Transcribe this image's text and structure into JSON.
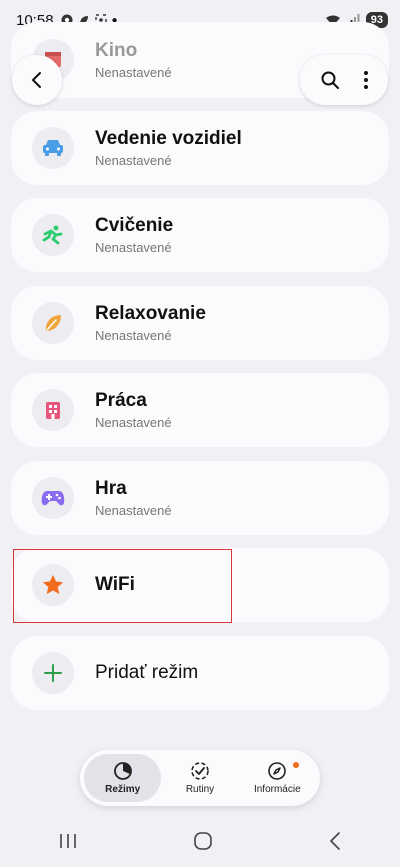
{
  "status_bar": {
    "time": "10:58",
    "battery": "93"
  },
  "header": {
    "back_icon": "chevron-left-icon",
    "search_icon": "search-icon",
    "more_icon": "more-vert-icon"
  },
  "modes": [
    {
      "title": "Kino",
      "subtitle": "Nenastavené",
      "icon": "film-icon"
    },
    {
      "title": "Vedenie vozidiel",
      "subtitle": "Nenastavené",
      "icon": "car-icon"
    },
    {
      "title": "Cvičenie",
      "subtitle": "Nenastavené",
      "icon": "running-icon"
    },
    {
      "title": "Relaxovanie",
      "subtitle": "Nenastavené",
      "icon": "leaf-icon"
    },
    {
      "title": "Práca",
      "subtitle": "Nenastavené",
      "icon": "building-icon"
    },
    {
      "title": "Hra",
      "subtitle": "Nenastavené",
      "icon": "gamepad-icon"
    },
    {
      "title": "WiFi",
      "icon": "star-icon"
    }
  ],
  "add_mode": {
    "label": "Pridať režim",
    "icon": "plus-icon"
  },
  "bottom_nav": {
    "tabs": [
      {
        "label": "Režimy",
        "icon": "modes-icon",
        "active": true
      },
      {
        "label": "Rutiny",
        "icon": "routines-icon",
        "active": false
      },
      {
        "label": "Informácie",
        "icon": "compass-icon",
        "active": false
      }
    ]
  },
  "colors": {
    "car": "#4a9ee8",
    "running": "#2ecc71",
    "leaf": "#f0a43c",
    "building": "#e8557a",
    "gamepad": "#8a6cf0",
    "star": "#f26b1d",
    "plus": "#2e9e4a",
    "highlight": "#d9383a"
  }
}
